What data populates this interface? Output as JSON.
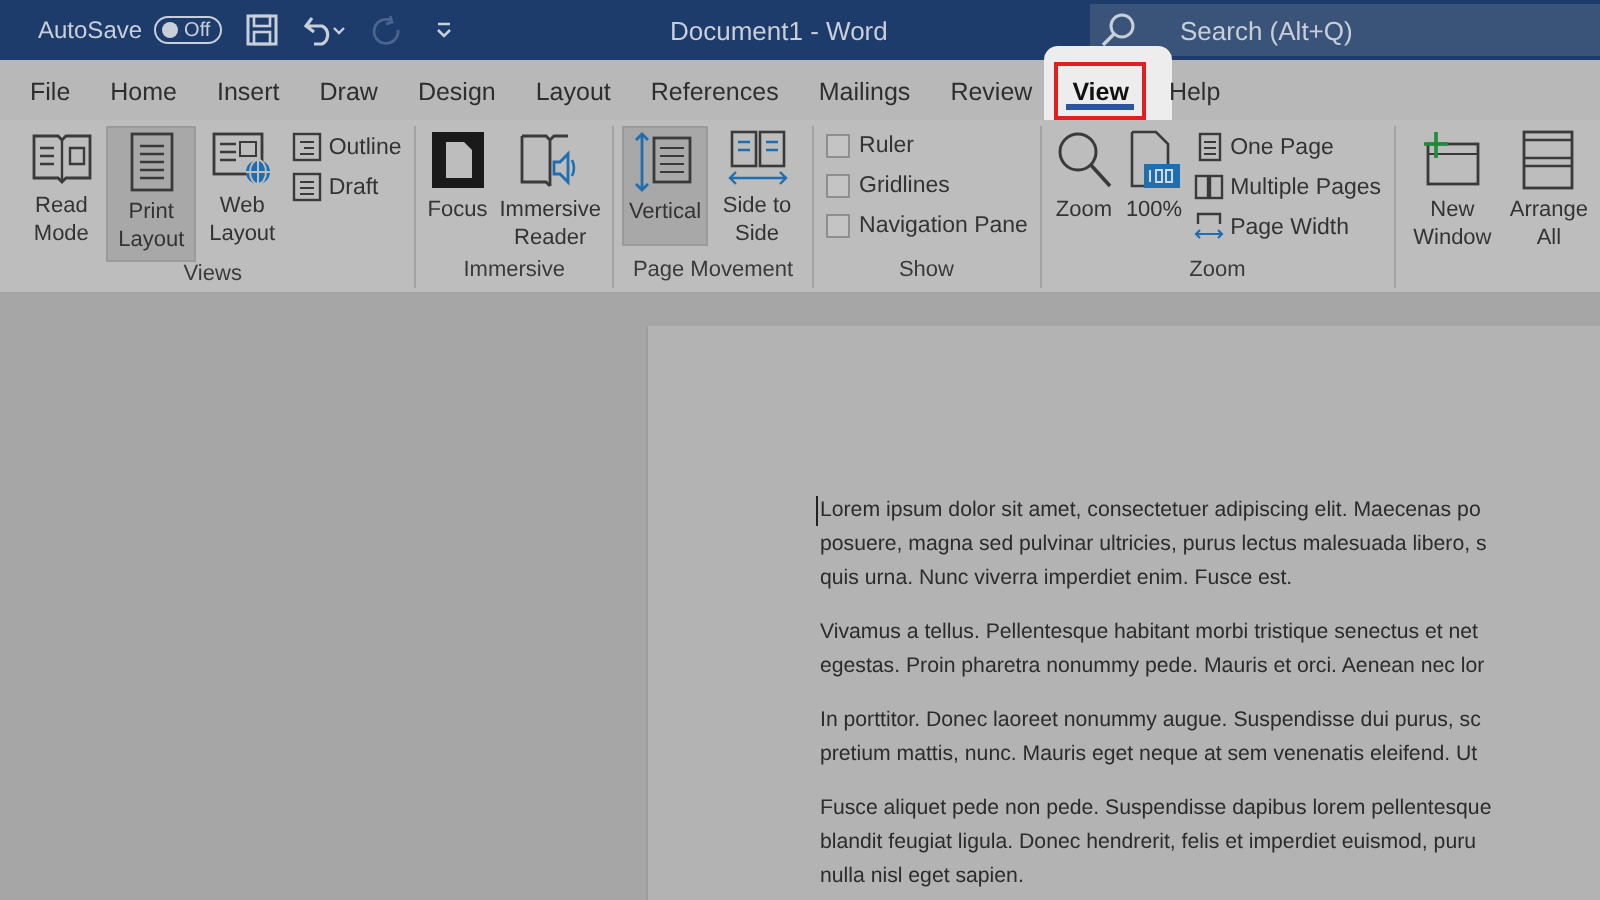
{
  "title_bar": {
    "autosave_label": "AutoSave",
    "autosave_toggle": {
      "label": "Off",
      "on": false
    },
    "document_title": "Document1  -  Word",
    "search": {
      "placeholder": "Search (Alt+Q)"
    }
  },
  "tabs": [
    {
      "label": "File",
      "selected": false,
      "highlighted": false
    },
    {
      "label": "Home",
      "selected": false,
      "highlighted": false
    },
    {
      "label": "Insert",
      "selected": false,
      "highlighted": false
    },
    {
      "label": "Draw",
      "selected": false,
      "highlighted": false
    },
    {
      "label": "Design",
      "selected": false,
      "highlighted": false
    },
    {
      "label": "Layout",
      "selected": false,
      "highlighted": false
    },
    {
      "label": "References",
      "selected": false,
      "highlighted": false
    },
    {
      "label": "Mailings",
      "selected": false,
      "highlighted": false
    },
    {
      "label": "Review",
      "selected": false,
      "highlighted": false
    },
    {
      "label": "View",
      "selected": true,
      "highlighted": true
    },
    {
      "label": "Help",
      "selected": false,
      "highlighted": false
    }
  ],
  "ribbon": {
    "groups": [
      {
        "label": "Views",
        "items": [
          {
            "kind": "large",
            "label": "Read Mode",
            "selected": false
          },
          {
            "kind": "large",
            "label": "Print Layout",
            "selected": true
          },
          {
            "kind": "large",
            "label": "Web Layout",
            "selected": false
          },
          {
            "kind": "small",
            "label": "Outline",
            "selected": false
          },
          {
            "kind": "small",
            "label": "Draft",
            "selected": false
          }
        ]
      },
      {
        "label": "Immersive",
        "items": [
          {
            "kind": "large",
            "label": "Focus",
            "selected": false
          },
          {
            "kind": "large",
            "label": "Immersive Reader",
            "selected": false
          }
        ]
      },
      {
        "label": "Page Movement",
        "items": [
          {
            "kind": "large",
            "label": "Vertical",
            "selected": true
          },
          {
            "kind": "large",
            "label": "Side to Side",
            "selected": false
          }
        ]
      },
      {
        "label": "Show",
        "items": [
          {
            "kind": "checkbox",
            "label": "Ruler",
            "checked": false
          },
          {
            "kind": "checkbox",
            "label": "Gridlines",
            "checked": false
          },
          {
            "kind": "checkbox",
            "label": "Navigation Pane",
            "checked": false
          }
        ]
      },
      {
        "label": "Zoom",
        "items": [
          {
            "kind": "large",
            "label": "Zoom",
            "selected": false
          },
          {
            "kind": "large",
            "label": "100%",
            "selected": false
          },
          {
            "kind": "small",
            "label": "One Page",
            "selected": false
          },
          {
            "kind": "small",
            "label": "Multiple Pages",
            "selected": false
          },
          {
            "kind": "small",
            "label": "Page Width",
            "selected": false
          }
        ]
      },
      {
        "items": [
          {
            "kind": "large",
            "label": "New Window",
            "selected": false
          },
          {
            "kind": "large",
            "label": "Arrange All",
            "selected": false
          }
        ]
      }
    ]
  },
  "document": {
    "paragraphs": [
      [
        "Lorem ipsum dolor sit amet, consectetuer adipiscing elit. Maecenas po",
        "posuere, magna sed pulvinar ultricies, purus lectus malesuada libero, s",
        "quis urna. Nunc viverra imperdiet enim. Fusce est."
      ],
      [
        "Vivamus a tellus. Pellentesque habitant morbi tristique senectus et net",
        "egestas. Proin pharetra nonummy pede. Mauris et orci. Aenean nec lor"
      ],
      [
        "In porttitor. Donec laoreet nonummy augue. Suspendisse dui purus, sc",
        "pretium mattis, nunc. Mauris eget neque at sem venenatis eleifend. Ut"
      ],
      [
        "Fusce aliquet pede non pede. Suspendisse dapibus lorem pellentesque",
        "blandit feugiat ligula. Donec hendrerit, felis et imperdiet euismod, puru",
        "nulla nisl eget sapien."
      ]
    ]
  }
}
